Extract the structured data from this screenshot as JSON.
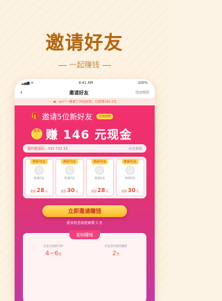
{
  "hero": {
    "title": "邀请好友",
    "subtitle": "一起赚钱"
  },
  "phone": {
    "statusbar": {
      "time": "9:41 AM",
      "battery": "100%"
    },
    "navbar": {
      "back": "‹",
      "title": "邀请好友",
      "rules": "活动规则"
    },
    "notice": "wo**一邀请了29位好友，已获得266.5元",
    "campaign": {
      "line1": "邀请5位新好友",
      "rule_badge": "活动规则",
      "max_badge": "最高",
      "amount_text": "赚 146 元现金",
      "invite_code_label": "我的邀请码：",
      "invite_code": "591 732 25",
      "copy_label": "点击复制",
      "cards": [
        {
          "tag": "邀请1位友",
          "status": "邀请好友",
          "reward_prefix": "奖励",
          "reward": "28",
          "reward_unit": "元"
        },
        {
          "tag": "邀请2位友",
          "status": "邀请好友",
          "reward_prefix": "奖励",
          "reward": "30",
          "reward_unit": "元"
        },
        {
          "tag": "邀请3位友",
          "status": "邀请好友",
          "reward_prefix": "奖励",
          "reward": "28",
          "reward_unit": "元"
        },
        {
          "tag": "邀请4位友",
          "status": "邀请好友",
          "reward_prefix": "奖励",
          "reward": "30",
          "reward_unit": "元"
        }
      ],
      "cta": "立即邀请赚钱",
      "countdown": "距本轮活动结束剩 3 天",
      "how_title": "如何赚钱",
      "how": [
        {
          "desc": "好友注册即可得",
          "value": "4~6",
          "unit": "元"
        },
        {
          "desc": "好友首次使用赚到",
          "value": "2",
          "unit": "元"
        }
      ]
    }
  },
  "colors": {
    "hero_title": "#b4640e",
    "campaign_gradient_top": "#f42f6e",
    "campaign_gradient_bottom": "#c33aa0",
    "cta_bg": "#ffc63a"
  }
}
